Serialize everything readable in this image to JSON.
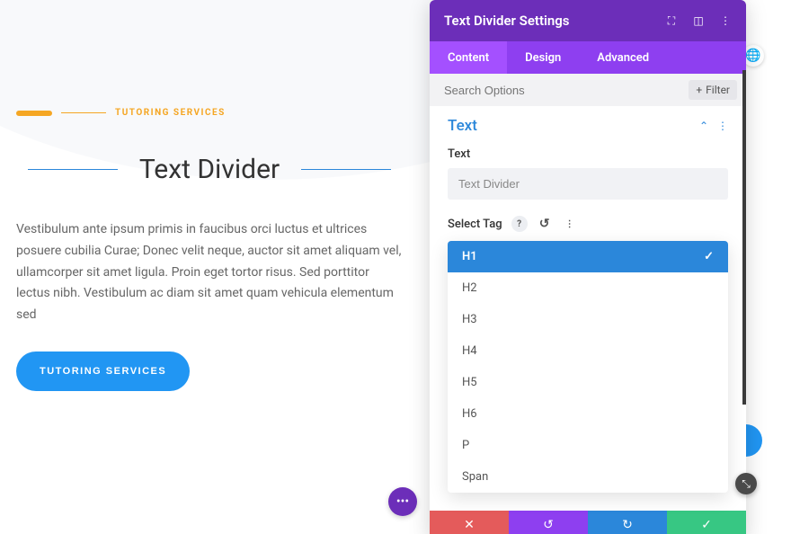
{
  "content": {
    "eyebrow": "TUTORING SERVICES",
    "divider_title": "Text Divider",
    "body": "Vestibulum ante ipsum primis in faucibus orci luctus et ultrices posuere cubilia Curae; Donec velit neque, auctor sit amet aliquam vel, ullamcorper sit amet ligula. Proin eget tortor risus. Sed porttitor lectus nibh. Vestibulum ac diam sit amet quam vehicula elementum sed",
    "cta": "TUTORING SERVICES"
  },
  "panel": {
    "title": "Text Divider Settings",
    "tabs": {
      "content": "Content",
      "design": "Design",
      "advanced": "Advanced",
      "active": "content"
    },
    "search_placeholder": "Search Options",
    "filter_label": "Filter",
    "sections": {
      "text": {
        "title": "Text",
        "field_text_label": "Text",
        "field_text_value": "Text Divider",
        "select_tag_label": "Select Tag",
        "options": [
          "H1",
          "H2",
          "H3",
          "H4",
          "H5",
          "H6",
          "P",
          "Span"
        ],
        "selected": "H1"
      }
    }
  },
  "icons": {
    "expand": "⛶",
    "columns": "◫",
    "more_v": "⋮",
    "plus": "+",
    "chevron_up": "⌃",
    "help": "?",
    "undo": "↺",
    "redo": "↻",
    "close": "✕",
    "check": "✓",
    "dots": "•••",
    "globe": "🌐",
    "resize": "⤡"
  },
  "colors": {
    "accent_blue": "#2b87da",
    "accent_orange": "#f5a623",
    "panel_purple": "#6c2eb9",
    "tab_purple": "#8e3ff0",
    "green": "#37c783",
    "red": "#e45b5b"
  }
}
